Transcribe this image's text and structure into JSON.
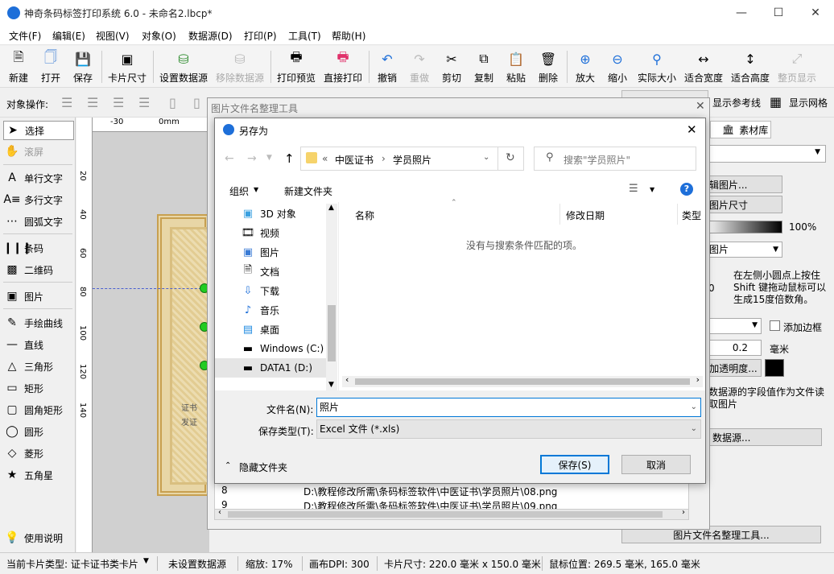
{
  "window": {
    "title": "神奇条码标签打印系统 6.0 - 未命名2.lbcp*"
  },
  "menu": [
    "文件(F)",
    "编辑(E)",
    "视图(V)",
    "对象(O)",
    "数据源(D)",
    "打印(P)",
    "工具(T)",
    "帮助(H)"
  ],
  "toolbar": {
    "new": "新建",
    "open": "打开",
    "save": "保存",
    "card_size": "卡片尺寸",
    "set_datasource": "设置数据源",
    "remove_datasource": "移除数据源",
    "print_preview": "打印预览",
    "direct_print": "直接打印",
    "undo": "撤销",
    "redo": "重做",
    "cut": "剪切",
    "copy": "复制",
    "paste": "粘贴",
    "delete": "删除",
    "zoom_in": "放大",
    "zoom_out": "缩小",
    "actual_size": "实际大小",
    "fit_width": "适合宽度",
    "fit_height": "适合高度",
    "full_page": "整页显示"
  },
  "objbar": {
    "label": "对象操作:",
    "show_guides": "显示参考线",
    "show_grid": "显示网格"
  },
  "lefttools": {
    "select": "选择",
    "scroll": "滚屏",
    "single_text": "单行文字",
    "multi_text": "多行文字",
    "arc_text": "圆弧文字",
    "barcode": "条码",
    "qrcode": "二维码",
    "image": "图片",
    "freehand": "手绘曲线",
    "line": "直线",
    "triangle": "三角形",
    "rect": "矩形",
    "round_rect": "圆角矩形",
    "circle": "圆形",
    "diamond": "菱形",
    "star": "五角星",
    "help": "使用说明"
  },
  "ruler": {
    "m30": "-30",
    "zero": "0mm",
    "v20": "20",
    "v40": "40",
    "v60": "60",
    "v80": "80",
    "v100": "100",
    "v120": "120",
    "v140": "140"
  },
  "card": {
    "line1": "证书",
    "line2": "发证"
  },
  "rightpanel": {
    "tab_library": "素材库",
    "edit_image": "辑图片...",
    "image_size": "图片尺寸",
    "percent": "100%",
    "select_image": "图片",
    "hint_num": "0",
    "hint": "在左侧小圆点上按住Shift 键拖动鼠标可以生成15度倍数角。",
    "add_border": "添加边框",
    "width_value": "0.2",
    "unit": "毫米",
    "transparency": "加透明度...",
    "datasource_hint": "数据源的字段值作为文件读取图片",
    "datasource_btn": "数据源...",
    "rename_tool": "图片文件名整理工具..."
  },
  "bgdialog": {
    "title": "图片文件名整理工具",
    "rows": [
      {
        "idx": "8",
        "path": "D:\\教程修改所需\\条码标签软件\\中医证书\\学员照片\\08.png"
      },
      {
        "idx": "9",
        "path": "D:\\教程修改所需\\条码标签软件\\中医证书\\学员照片\\09.png"
      }
    ]
  },
  "savedlg": {
    "title": "另存为",
    "breadcrumb_prefix": "«",
    "crumb1": "中医证书",
    "crumb2": "学员照片",
    "search_placeholder": "搜索\"学员照片\"",
    "organize": "组织",
    "new_folder": "新建文件夹",
    "nav": [
      "3D 对象",
      "视频",
      "图片",
      "文档",
      "下载",
      "音乐",
      "桌面",
      "Windows (C:)",
      "DATA1 (D:)"
    ],
    "col_name": "名称",
    "col_date": "修改日期",
    "col_type": "类型",
    "empty": "没有与搜索条件匹配的项。",
    "filename_label": "文件名(N):",
    "filename": "照片",
    "filetype_label": "保存类型(T):",
    "filetype": "Excel 文件 (*.xls)",
    "hide_folders": "隐藏文件夹",
    "save": "保存(S)",
    "cancel": "取消"
  },
  "status": {
    "card_type": "当前卡片类型: 证卡证书类卡片",
    "datasource": "未设置数据源",
    "zoom": "缩放: 17%",
    "dpi": "画布DPI: 300",
    "card_size": "卡片尺寸: 220.0 毫米 x 150.0 毫米",
    "mouse": "鼠标位置: 269.5 毫米, 165.0 毫米"
  },
  "colors": {
    "accent": "#0078d7",
    "app_icon": "#1e6fd9",
    "handle": "#22cc22",
    "card_frame": "#c8a050"
  }
}
